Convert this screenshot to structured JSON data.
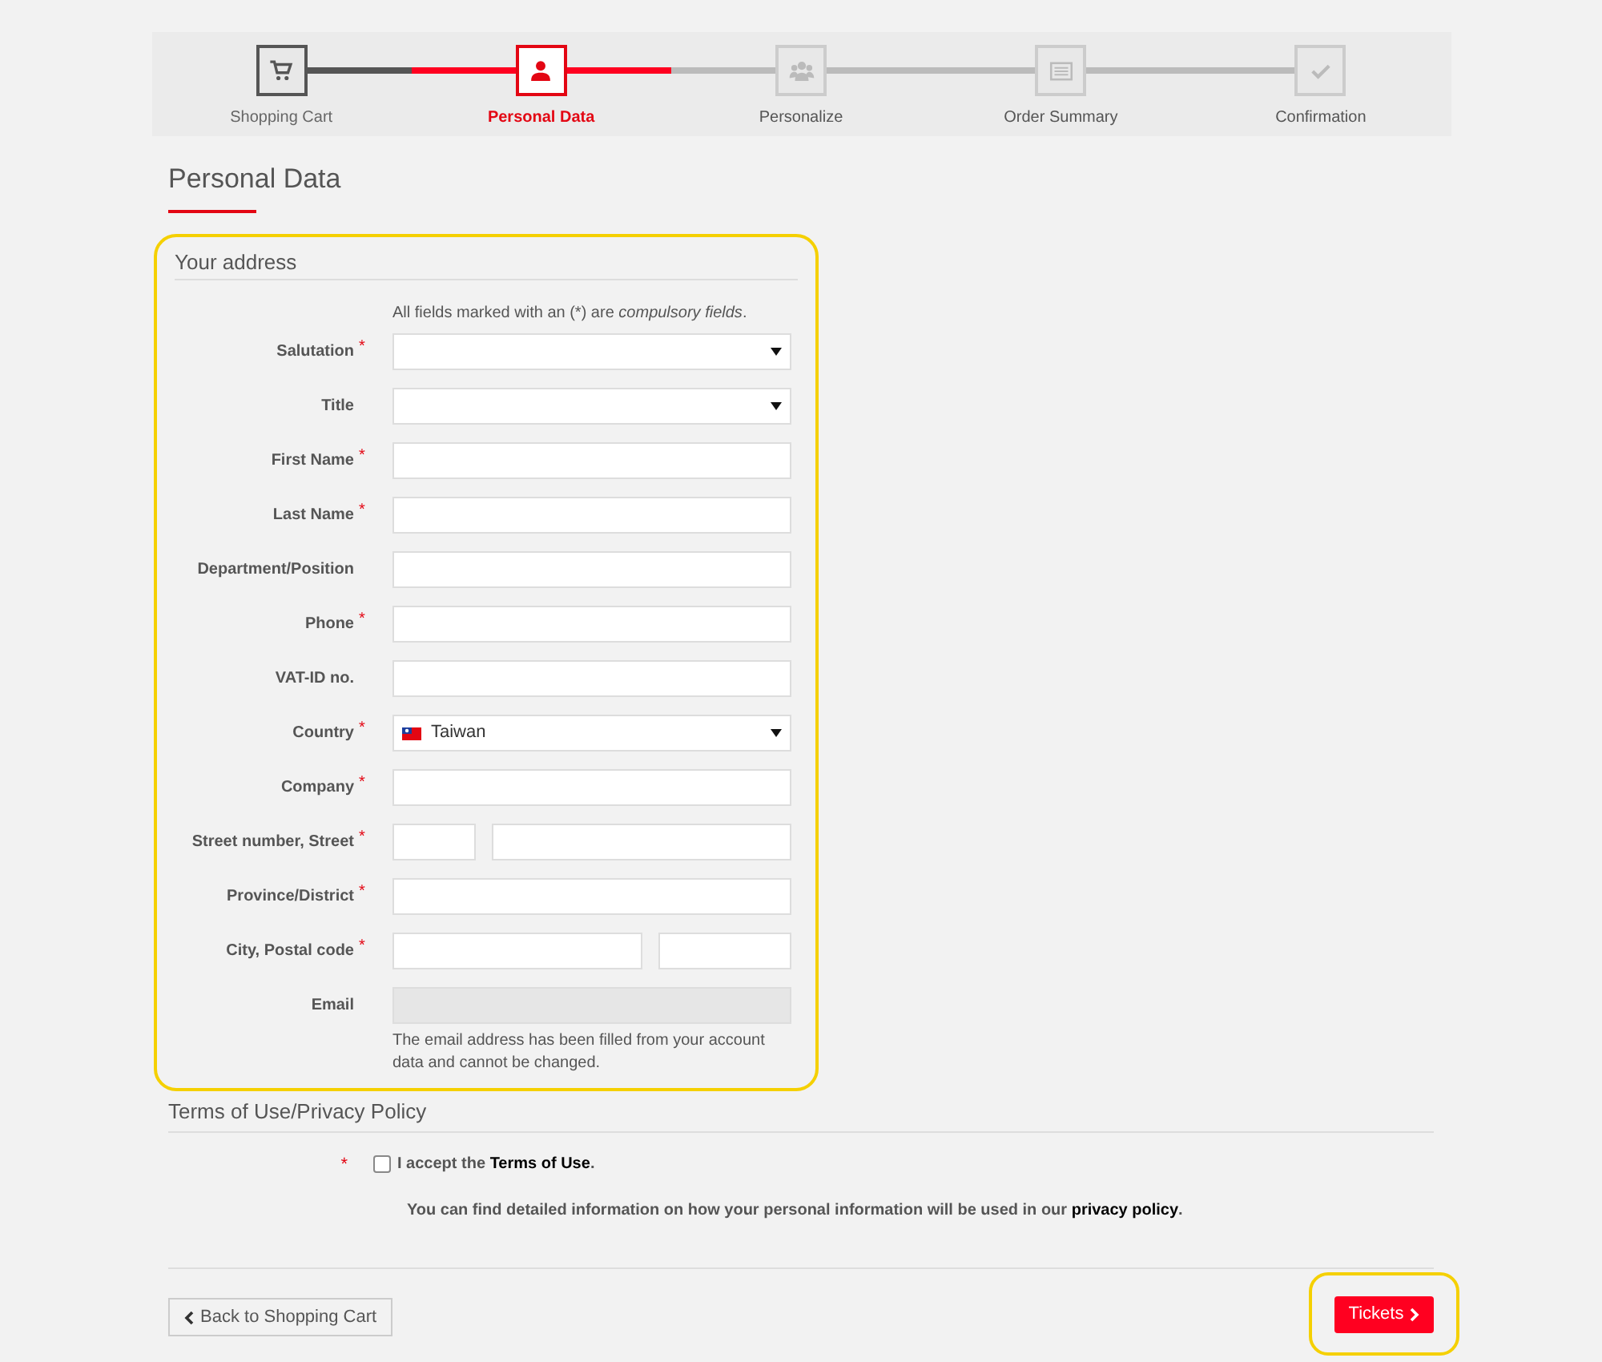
{
  "steps": [
    {
      "label": "Shopping Cart",
      "completed": true,
      "selected": false
    },
    {
      "label": "Personal Data",
      "completed": false,
      "selected": true
    },
    {
      "label": "Personalize",
      "completed": false,
      "selected": false
    },
    {
      "label": "Order Summary",
      "completed": false,
      "selected": false
    },
    {
      "label": "Confirmation",
      "completed": false,
      "selected": false
    }
  ],
  "page_title": "Personal Data",
  "address": {
    "title": "Your address",
    "highlighted": true,
    "hint": "All fields marked with an (*) are *compulsory fields*.",
    "fields": [
      {
        "label": "Salutation",
        "mark": "*",
        "kind": "select"
      },
      {
        "label": "Title",
        "kind": "select"
      },
      {
        "label": "First Name",
        "mark": "*",
        "kind": "text"
      },
      {
        "label": "Last Name",
        "mark": "*",
        "kind": "text"
      },
      {
        "label": "Department/Position",
        "kind": "text"
      },
      {
        "label": "Phone",
        "mark": "*",
        "kind": "text"
      },
      {
        "label": "VAT-ID no.",
        "kind": "text"
      },
      {
        "label": "Country",
        "mark": "*",
        "kind": "country",
        "value": "Taiwan"
      },
      {
        "label": "Company",
        "mark": "*",
        "kind": "text"
      },
      {
        "label": "Street number, Street",
        "mark": "*",
        "kind": "pair-short-long"
      },
      {
        "label": "Province/District",
        "mark": "*",
        "kind": "text"
      },
      {
        "label": "City, Postal code",
        "mark": "*",
        "kind": "pair-long-short"
      },
      {
        "label": "Email",
        "kind": "text",
        "disabled": true,
        "note": "The email address has been filled from your account data and cannot be changed."
      }
    ]
  },
  "terms": {
    "title": "Terms of Use/Privacy Policy",
    "mark": "*",
    "checked": false,
    "accept": "I accept the **Terms of Use**.",
    "info": "You can find detailed information on how your personal information will be used in our **privacy policy**."
  },
  "back_button": "Back to Shopping Cart",
  "next_button": {
    "label": "Tickets",
    "highlighted": true
  }
}
